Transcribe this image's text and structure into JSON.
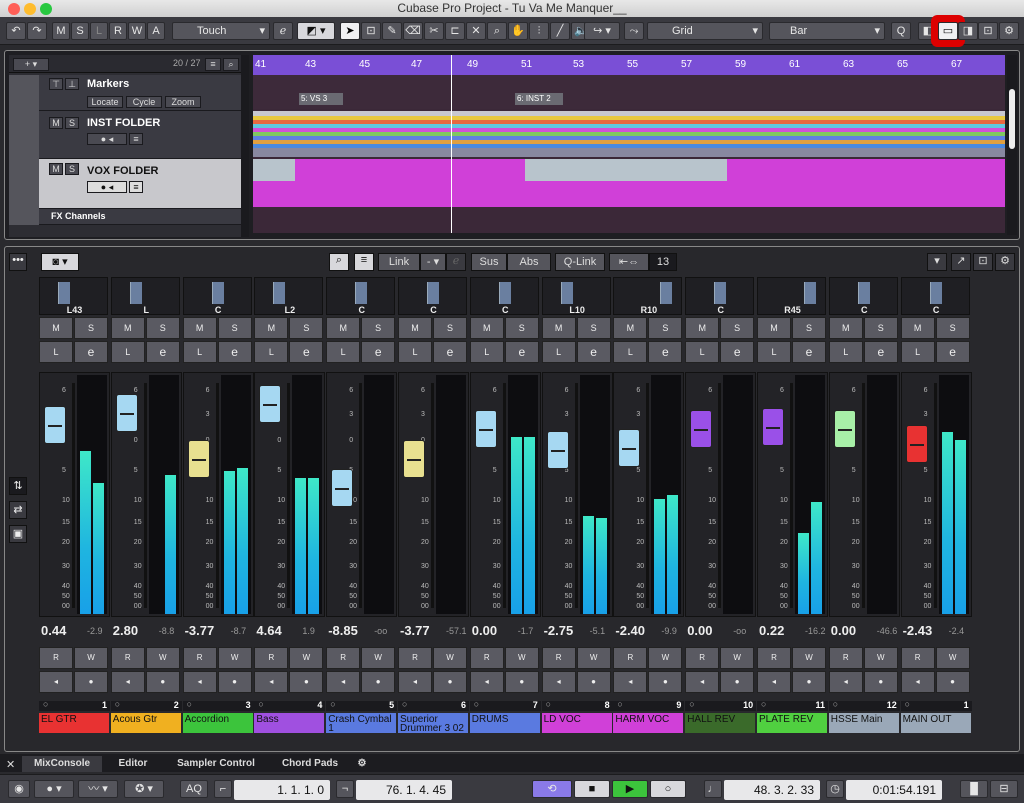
{
  "window": {
    "title": "Cubase Pro Project - Tu Va Me Manquer__"
  },
  "toolbar": {
    "m": "M",
    "s": "S",
    "l": "L",
    "r": "R",
    "w": "W",
    "a": "A",
    "automation_mode": "Touch",
    "snap_type": "Grid",
    "grid_type": "Bar",
    "quantize": "Q"
  },
  "tracklist": {
    "count": "20 / 27",
    "markers": {
      "name": "Markers",
      "locate": "Locate",
      "cycle": "Cycle",
      "zoom": "Zoom"
    },
    "tracks": [
      {
        "name": "INST FOLDER"
      },
      {
        "name": "VOX FOLDER"
      },
      {
        "name": "FX Channels"
      }
    ]
  },
  "ruler": {
    "bars": [
      "41",
      "43",
      "45",
      "47",
      "49",
      "51",
      "53",
      "55",
      "57",
      "59",
      "61",
      "63",
      "65",
      "67"
    ],
    "marker1": "5: VS 3",
    "marker2": "6: INST 2"
  },
  "mixer": {
    "link": "Link",
    "dash": "-",
    "sus": "Sus",
    "abs": "Abs",
    "qlink": "Q-Link",
    "count": "13",
    "m": "M",
    "s": "S",
    "l": "L",
    "e": "e",
    "r": "R",
    "w": "W",
    "scale": [
      "6",
      "3",
      "0",
      "5",
      "10",
      "15",
      "20",
      "30",
      "40",
      "50",
      "00"
    ],
    "channels": [
      {
        "num": "1",
        "name": "EL GTR",
        "pan": "L43",
        "vol": "0.44",
        "peak": "-2.9",
        "color": "#e83232",
        "fader": "#a6d8f2",
        "fader_pos": 0.12,
        "meters": [
          0.68,
          0.55
        ]
      },
      {
        "num": "2",
        "name": "Acous Gtr",
        "pan": "L",
        "vol": "2.80",
        "peak": "-8.8",
        "color": "#f0b020",
        "fader": "#a6d8f2",
        "fader_pos": 0.06,
        "meters": [
          0,
          0.58
        ]
      },
      {
        "num": "3",
        "name": "Accordion",
        "pan": "C",
        "vol": "-3.77",
        "peak": "-8.7",
        "color": "#3cc43c",
        "fader": "#e8e090",
        "fader_pos": 0.3,
        "meters": [
          0.6,
          0.61
        ]
      },
      {
        "num": "4",
        "name": "Bass",
        "pan": "L2",
        "vol": "4.64",
        "peak": "1.9",
        "color": "#a050e0",
        "fader": "#a6d8f2",
        "fader_pos": 0.01,
        "meters": [
          0.57,
          0.57
        ]
      },
      {
        "num": "5",
        "name": "Crash Cymbal 1",
        "pan": "C",
        "vol": "-8.85",
        "peak": "-oo",
        "color": "#5a7ae0",
        "fader": "#a6d8f2",
        "fader_pos": 0.45,
        "meters": [
          0,
          0
        ]
      },
      {
        "num": "6",
        "name": "Superior Drummer 3 02",
        "pan": "C",
        "vol": "-3.77",
        "peak": "-57.1",
        "color": "#5a7ae0",
        "fader": "#e8e090",
        "fader_pos": 0.3,
        "meters": [
          0,
          0
        ]
      },
      {
        "num": "7",
        "name": "DRUMS",
        "pan": "C",
        "vol": "0.00",
        "peak": "-1.7",
        "color": "#5a7ae0",
        "fader": "#a6d8f2",
        "fader_pos": 0.14,
        "meters": [
          0.74,
          0.74
        ]
      },
      {
        "num": "8",
        "name": "LD VOC",
        "pan": "L10",
        "vol": "-2.75",
        "peak": "-5.1",
        "color": "#d040d8",
        "fader": "#a6d8f2",
        "fader_pos": 0.25,
        "meters": [
          0.41,
          0.4
        ]
      },
      {
        "num": "9",
        "name": "HARM VOC",
        "pan": "R10",
        "vol": "-2.40",
        "peak": "-9.9",
        "color": "#d040d8",
        "fader": "#a6d8f2",
        "fader_pos": 0.24,
        "meters": [
          0.48,
          0.5
        ]
      },
      {
        "num": "10",
        "name": "HALL REV",
        "pan": "C",
        "vol": "0.00",
        "peak": "-oo",
        "color": "#3a6a2a",
        "fader": "#9a50e8",
        "fader_pos": 0.14,
        "meters": [
          0,
          0
        ]
      },
      {
        "num": "11",
        "name": "PLATE REV",
        "pan": "R45",
        "vol": "0.22",
        "peak": "-16.2",
        "color": "#50d040",
        "fader": "#9a50e8",
        "fader_pos": 0.13,
        "meters": [
          0.34,
          0.47
        ]
      },
      {
        "num": "12",
        "name": "HSSE Main",
        "pan": "C",
        "vol": "0.00",
        "peak": "-46.6",
        "color": "#9aa8b8",
        "fader": "#a8f0a8",
        "fader_pos": 0.14,
        "meters": [
          0,
          0
        ]
      },
      {
        "num": "1",
        "name": "MAIN OUT",
        "pan": "C",
        "vol": "-2.43",
        "peak": "-2.4",
        "color": "#9aa8b8",
        "fader": "#e83232",
        "fader_pos": 0.22,
        "meters": [
          0.76,
          0.73
        ]
      }
    ]
  },
  "tabs": {
    "mixconsole": "MixConsole",
    "editor": "Editor",
    "sampler": "Sampler Control",
    "chord": "Chord Pads"
  },
  "transport": {
    "aq": "AQ",
    "left": "1.  1.  1.    0",
    "right": "76.  1.  4.  45",
    "pos": "48.  3.  2.  33",
    "time": "0:01:54.191"
  }
}
